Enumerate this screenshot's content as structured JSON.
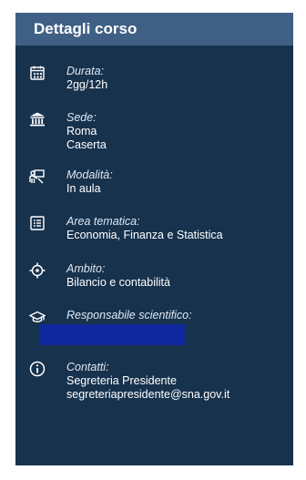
{
  "panel": {
    "title": "Dettagli corso",
    "items": [
      {
        "icon": "calendar-icon",
        "label": "Durata:",
        "values": [
          "2gg/12h"
        ]
      },
      {
        "icon": "building-icon",
        "label": "Sede:",
        "values": [
          "Roma",
          "Caserta"
        ]
      },
      {
        "icon": "presenter-icon",
        "label": "Modalità:",
        "values": [
          "In aula"
        ]
      },
      {
        "icon": "list-icon",
        "label": "Area tematica:",
        "values": [
          "Economia, Finanza e Statistica"
        ]
      },
      {
        "icon": "target-icon",
        "label": "Ambito:",
        "values": [
          "Bilancio e contabilità"
        ]
      },
      {
        "icon": "graduation-cap-icon",
        "label": "Responsabile scientifico:",
        "values": []
      },
      {
        "icon": "info-icon",
        "label": "Contatti:",
        "values": [
          "Segreteria Presidente",
          "segreteriapresidente@sna.gov.it"
        ]
      }
    ]
  },
  "colors": {
    "panel_bg": "#17324d",
    "header_bg": "#3f5f84",
    "redaction": "#10289e"
  }
}
